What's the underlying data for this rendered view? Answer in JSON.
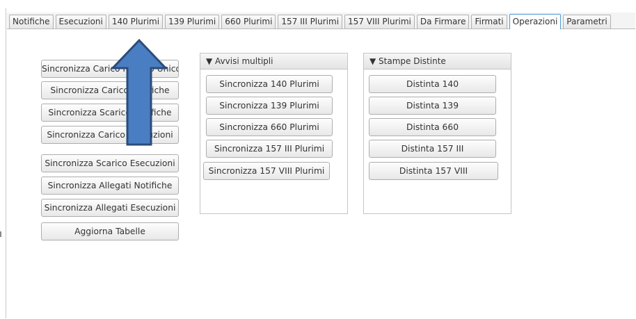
{
  "tabs": [
    {
      "label": "Notifiche"
    },
    {
      "label": "Esecuzioni"
    },
    {
      "label": "140 Plurimi"
    },
    {
      "label": "139 Plurimi"
    },
    {
      "label": "660 Plurimi"
    },
    {
      "label": "157 III Plurimi"
    },
    {
      "label": "157 VIII Plurimi"
    },
    {
      "label": "Da Firmare"
    },
    {
      "label": "Firmati"
    },
    {
      "label": "Operazioni"
    },
    {
      "label": "Parametri"
    }
  ],
  "active_tab": "Operazioni",
  "left_buttons": [
    "Sincronizza Carico Ricorso Unico",
    "Sincronizza Carico Notifiche",
    "Sincronizza Scarico Notifiche",
    "Sincronizza Carico Esecuzioni",
    "Sincronizza Scarico Esecuzioni",
    "Sincronizza Allegati Notifiche",
    "Sincronizza Allegati Esecuzioni",
    "Aggiorna Tabelle"
  ],
  "avvisi_panel": {
    "title": "▼  Avvisi multipli",
    "buttons": [
      "Sincronizza 140 Plurimi",
      "Sincronizza 139 Plurimi",
      "Sincronizza 660 Plurimi",
      "Sincronizza 157 III Plurimi",
      "Sincronizza 157 VIII Plurimi"
    ]
  },
  "stampe_panel": {
    "title": "▼  Stampe Distinte",
    "buttons": [
      "Distinta 140",
      "Distinta 139",
      "Distinta 660",
      "Distinta 157 III",
      "Distinta 157 VIII"
    ]
  },
  "annotation": {
    "icon": "arrow-up-icon",
    "fill": "#4a7ec2",
    "stroke": "#2b4c7a"
  },
  "colors": {
    "active_tab_border": "#4a9ad4"
  }
}
